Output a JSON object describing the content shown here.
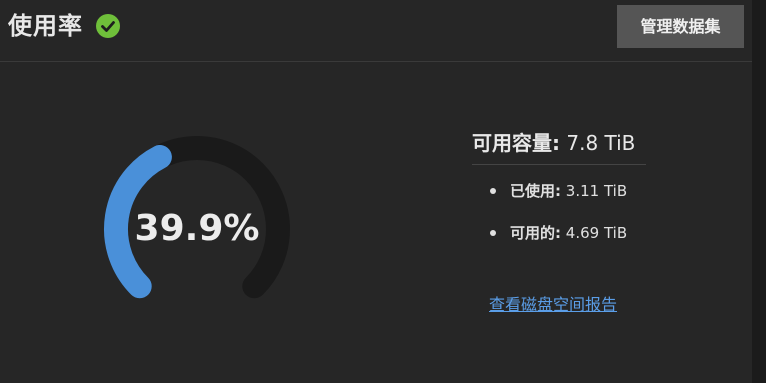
{
  "header": {
    "title": "使用率",
    "status_icon": "check-circle-icon",
    "status_color": "#6fbf3a",
    "manage_button_label": "管理数据集"
  },
  "gauge": {
    "percent": 39.9,
    "label": "39.9%",
    "fill_color": "#4a90d9",
    "track_color": "#1a1a1a"
  },
  "capacity": {
    "label": "可用容量:",
    "value": "7.8 TiB"
  },
  "stats": [
    {
      "label": "已使用:",
      "value": "3.11 TiB"
    },
    {
      "label": "可用的:",
      "value": "4.69 TiB"
    }
  ],
  "report_link_label": "查看磁盘空间报告"
}
